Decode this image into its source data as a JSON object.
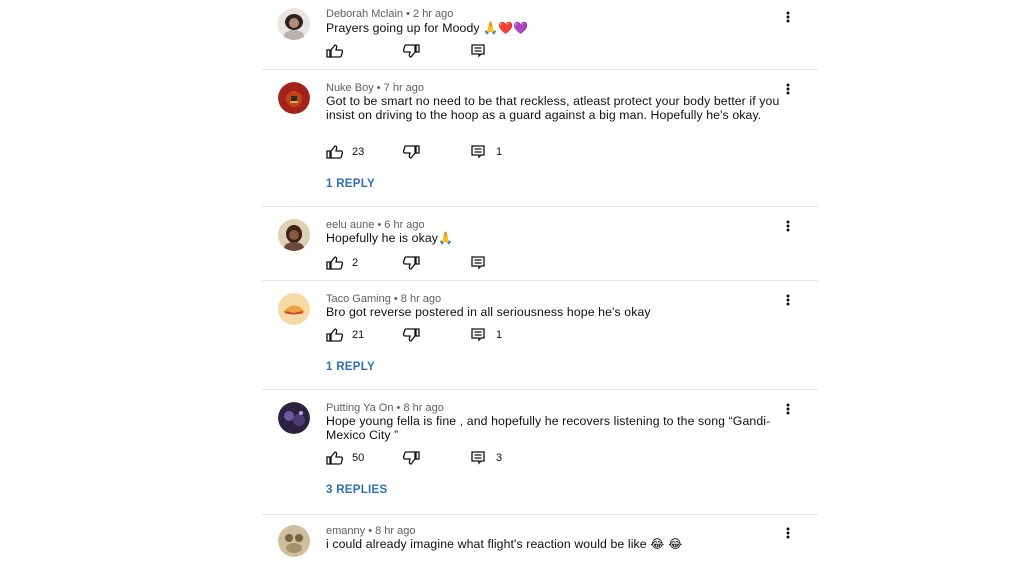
{
  "comments": [
    {
      "author": "Deborah Mclain",
      "time": "2 hr ago",
      "text": "Prayers going up for Moody",
      "emoji": "🙏❤️💜",
      "likes": "",
      "replies_count": "",
      "replies_link": "",
      "avatar_color": "#c9b9b0"
    },
    {
      "author": "Nuke Boy",
      "time": "7 hr ago",
      "text": "Got to be smart no need to be that reckless, atleast protect your body better if you insist on driving to the hoop as a guard against a big man. Hopefully he's okay.",
      "emoji": "",
      "likes": "23",
      "replies_count": "1",
      "replies_link": "1 REPLY",
      "avatar_color": "#b3261e"
    },
    {
      "author": "eelu aune",
      "time": "6 hr ago",
      "text": "Hopefully he is okay",
      "emoji": "🙏",
      "likes": "2",
      "replies_count": "",
      "replies_link": "",
      "avatar_color": "#d8c9a8"
    },
    {
      "author": "Taco Gaming",
      "time": "8 hr ago",
      "text": "Bro got reverse postered in all seriousness hope he's okay",
      "emoji": "",
      "likes": "21",
      "replies_count": "1",
      "replies_link": "1 REPLY",
      "avatar_color": "#f3c27a"
    },
    {
      "author": "Putting Ya On",
      "time": "8 hr ago",
      "text": "Hope young fella is fine , and hopefully he recovers listening to the song “Gandi- Mexico City ”",
      "emoji": "",
      "likes": "50",
      "replies_count": "3",
      "replies_link": "3 REPLIES",
      "avatar_color": "#5b4a7a"
    },
    {
      "author": "emanny",
      "time": "8 hr ago",
      "text": "i could already imagine what flight's reaction would be like",
      "emoji": "😂 😂",
      "likes": "",
      "replies_count": "",
      "replies_link": "",
      "avatar_color": "#a88f6a"
    }
  ],
  "icons": {
    "like": "thumbs-up-icon",
    "dislike": "thumbs-down-icon",
    "reply": "comment-icon",
    "menu": "more-vert-icon"
  },
  "colors": {
    "link": "#2f6fb6",
    "meta": "#606060",
    "divider": "#e4e4e4"
  }
}
